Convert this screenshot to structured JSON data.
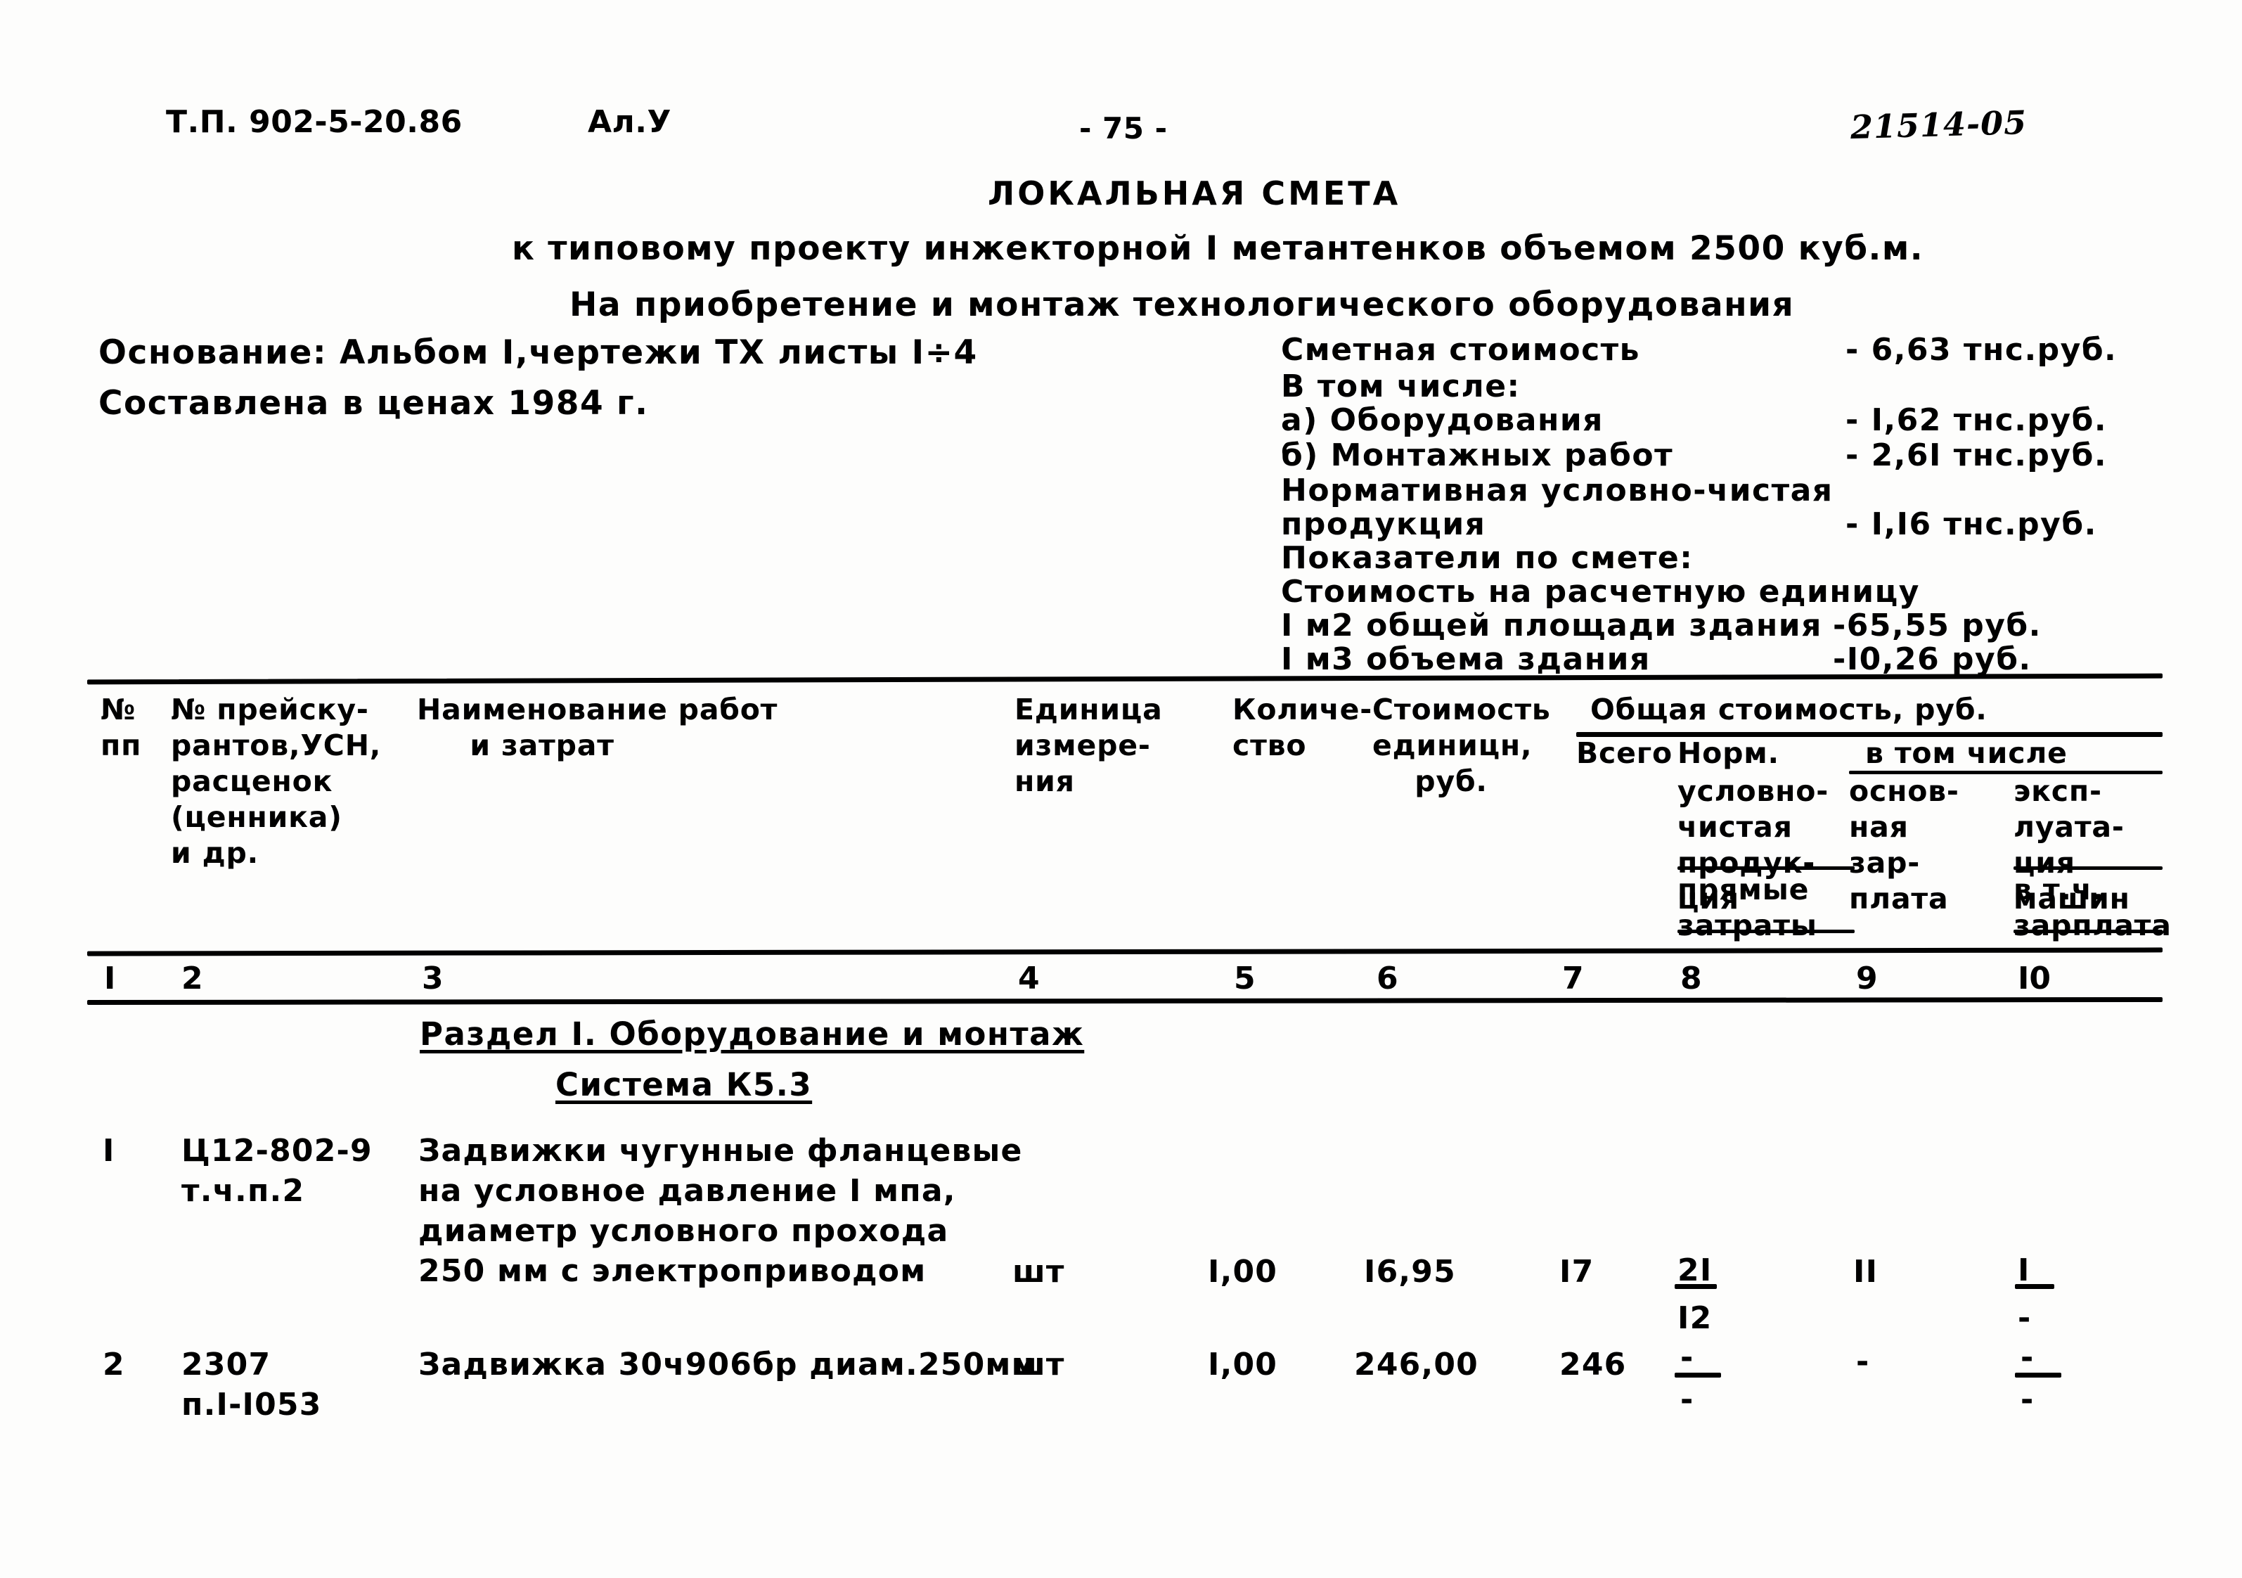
{
  "header": {
    "project_code": "Т.П. 902-5-20.86",
    "album": "Ал.У",
    "page_number": "- 75 -",
    "archive_stamp": "21514-05"
  },
  "titles": {
    "main": "ЛОКАЛЬНАЯ СМЕТА",
    "sub1": "к типовому проекту инжекторной I метантенков объемом 2500 куб.м.",
    "sub2": "На приобретение и монтаж технологического оборудования"
  },
  "info": {
    "basis": "Основание: Альбом I,чертежи ТХ листы I÷4",
    "prices": "Составлена в ценах 1984 г."
  },
  "summary": {
    "rows": [
      {
        "label": "Сметная стоимость",
        "value": "- 6,63 тнс.руб."
      },
      {
        "label": "В том числе:",
        "value": ""
      },
      {
        "label": "а) Оборудования",
        "value": "- I,62 тнс.руб."
      },
      {
        "label": "б) Монтажных работ",
        "value": "- 2,6I тнс.руб."
      },
      {
        "label": "Нормативная условно-чистая",
        "value": ""
      },
      {
        "label": "продукция",
        "value": "- I,I6 тнс.руб."
      },
      {
        "label": "Показатели по смете:",
        "value": ""
      },
      {
        "label": "Стоимость на расчетную единицу",
        "value": ""
      },
      {
        "label": "I м2 общей площади здания",
        "value": "-65,55 руб."
      },
      {
        "label": "I м3 объема здания",
        "value": "-I0,26 руб."
      }
    ]
  },
  "table": {
    "headers": {
      "c1": "№\nпп",
      "c2": "№ прейску-\nрантов,УСН,\nрасценок\n(ценника)\nи др.",
      "c3": "Наименование работ\n     и затрат",
      "c4": "Единица\nизмере-\nния",
      "c5": "Количе-\nство",
      "c6": "Стоимость\nединицн,\n    руб.",
      "group": "Общая стоимость, руб.",
      "c7": "Всего",
      "c8_top": "Норм.",
      "in_which": "в том числе",
      "c8": "условно-\nчистая\nпродук-\nция",
      "c8_bottom": "прямые\nзатраты",
      "c9": "основ-\nная\nзар-\nплата",
      "c10": "эксп-\nлуата-\nция\nмашин",
      "c10_bottom": "в т.ч.\nзарплата"
    },
    "column_numbers": [
      "I",
      "2",
      "3",
      "4",
      "5",
      "6",
      "7",
      "8",
      "9",
      "I0"
    ],
    "column_number_x": [
      148,
      258,
      600,
      1448,
      1755,
      1958,
      2222,
      2390,
      2640,
      2870
    ],
    "sections": [
      {
        "title": "Раздел I. Оборудование и монтаж"
      },
      {
        "title": "Система К5.3"
      }
    ],
    "rows": [
      {
        "c1": "I",
        "c2": "Ц12-802-9\nт.ч.п.2",
        "c3": "Задвижки чугунные фланцевые\nна условное давление I мпа,\nдиаметр условного прохода\n250 мм с электроприводом",
        "c4": "шт",
        "c5": "I,00",
        "c6": "I6,95",
        "c7": "I7",
        "c8_num": "2I",
        "c8_den": "I2",
        "c9": "II",
        "c10_num": "I",
        "c10_den": "-"
      },
      {
        "c1": "2",
        "c2": "2307\nп.I-I053",
        "c3": "Задвижка 30ч906бр диам.250мм",
        "c4": "шт",
        "c5": "I,00",
        "c6": "246,00",
        "c7": "246",
        "c8_num": "-",
        "c8_den": "-",
        "c9": "-",
        "c10_num": "-",
        "c10_den": "-"
      }
    ]
  },
  "colors": {
    "ink": "#000000",
    "paper": "#fdfdfc"
  }
}
